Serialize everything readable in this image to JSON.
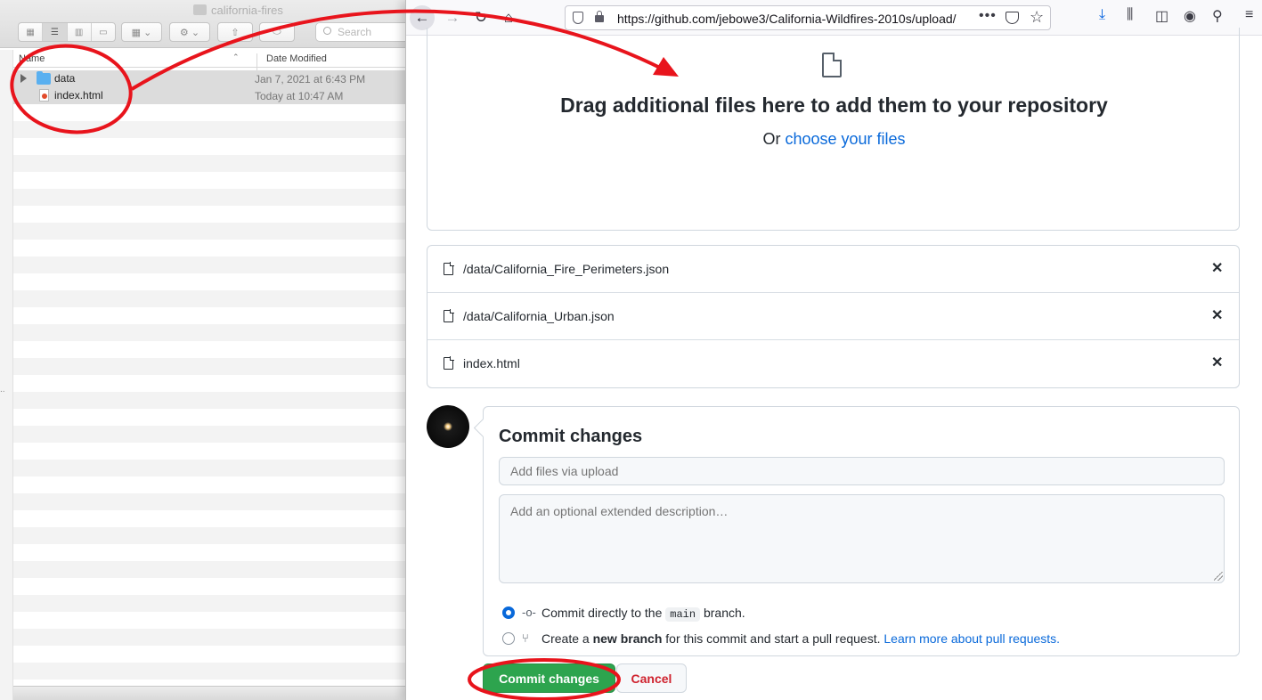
{
  "finder": {
    "title": "california-fires",
    "search_placeholder": "Search",
    "columns": {
      "name": "Name",
      "date": "Date Modified"
    },
    "rows": [
      {
        "name": "data",
        "date": "Jan 7, 2021 at 6:43 PM",
        "kind": "folder"
      },
      {
        "name": "index.html",
        "date": "Today at 10:47 AM",
        "kind": "html-file"
      }
    ],
    "side_dots": ".."
  },
  "browser": {
    "url": "https://github.com/jebowe3/California-Wildfires-2010s/upload/",
    "more": "•••"
  },
  "upload": {
    "drop_title": "Drag additional files here to add them to your repository",
    "or_text": "Or",
    "choose_link": "choose your files",
    "files": [
      "/data/California_Fire_Perimeters.json",
      "/data/California_Urban.json",
      "index.html"
    ]
  },
  "commit": {
    "title": "Commit changes",
    "summary_placeholder": "Add files via upload",
    "description_placeholder": "Add an optional extended description…",
    "option_direct": {
      "before": "Commit directly to the ",
      "branch": "main",
      "after": " branch."
    },
    "option_new": {
      "before": "Create a ",
      "bold": "new branch",
      "after": " for this commit and start a pull request. ",
      "link": "Learn more about pull requests."
    },
    "commit_button": "Commit changes",
    "cancel_button": "Cancel"
  },
  "colors": {
    "github_green": "#2da44e",
    "link_blue": "#0969da",
    "annotation_red": "#e8141c",
    "finder_folder": "#5ab0f0"
  }
}
